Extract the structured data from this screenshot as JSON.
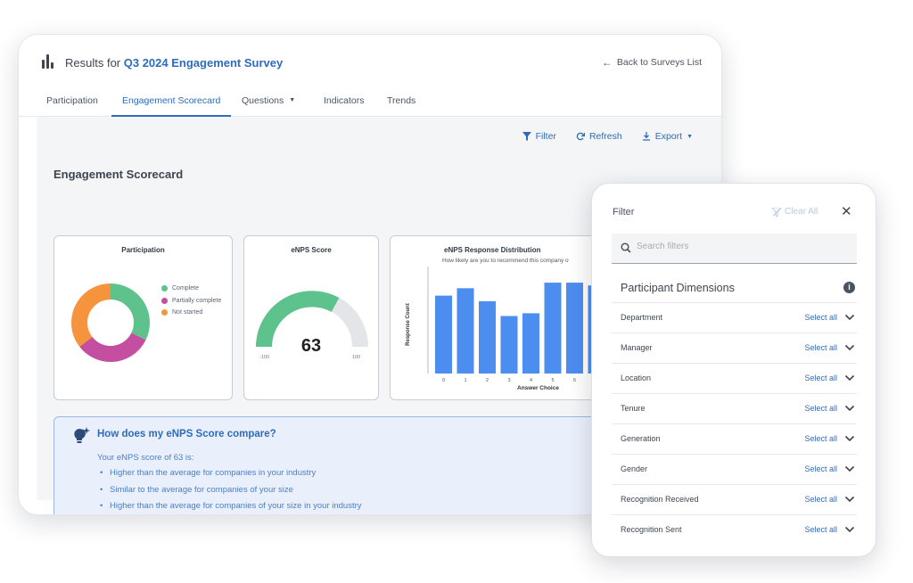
{
  "header": {
    "title_prefix": "Results for ",
    "survey_name": "Q3 2024 Engagement Survey",
    "back_link": "Back to Surveys List"
  },
  "tabs": [
    {
      "label": "Participation"
    },
    {
      "label": "Engagement Scorecard"
    },
    {
      "label": "Questions"
    },
    {
      "label": "Indicators"
    },
    {
      "label": "Trends"
    }
  ],
  "toolbar": {
    "filter": "Filter",
    "refresh": "Refresh",
    "export": "Export"
  },
  "section_title": "Engagement Scorecard",
  "participation_card": {
    "title": "Participation",
    "legend": [
      {
        "label": "Complete",
        "color": "#5ec28c"
      },
      {
        "label": "Partially complete",
        "color": "#c44fa0"
      },
      {
        "label": "Not started",
        "color": "#f5943c"
      }
    ]
  },
  "enps_card": {
    "title": "eNPS Score",
    "value": "63",
    "min": "-100",
    "max": "100"
  },
  "distribution_card": {
    "title": "eNPS Response Distribution",
    "subtitle": "How likely are you to recommend this company o",
    "ylabel": "Response Count",
    "xlabel": "Answer Choice"
  },
  "chart_data": {
    "type": "bar",
    "categories": [
      "0",
      "1",
      "2",
      "3",
      "4",
      "5",
      "6",
      "7"
    ],
    "values": [
      84,
      92,
      78,
      62,
      65,
      98,
      98,
      95
    ],
    "ylim": [
      0,
      100
    ],
    "bar_color": "#4c8df0"
  },
  "compare_box": {
    "title": "How does my eNPS Score compare?",
    "intro": "Your eNPS score of 63 is:",
    "points": [
      "Higher than the average for companies in your industry",
      "Similar to the average for companies of your size",
      "Higher than the average for companies of your size in your industry"
    ]
  },
  "filter_panel": {
    "title": "Filter",
    "clear_all": "Clear All",
    "search_placeholder": "Search filters",
    "section": "Participant Dimensions",
    "select_all_label": "Select all",
    "dimensions": [
      "Department",
      "Manager",
      "Location",
      "Tenure",
      "Generation",
      "Gender",
      "Recognition Received",
      "Recognition Sent"
    ]
  }
}
